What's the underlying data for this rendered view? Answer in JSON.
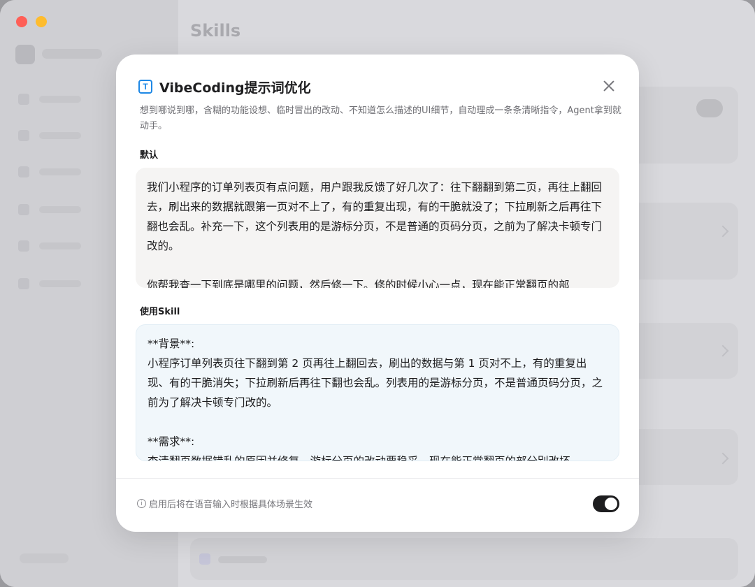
{
  "background": {
    "page_title": "Skills"
  },
  "modal": {
    "icon": "text-T-icon",
    "title": "VibeCoding提示词优化",
    "subtitle": "想到哪说到哪，含糊的功能设想、临时冒出的改动、不知道怎么描述的UI细节，自动理成一条条清晰指令，Agent拿到就动手。",
    "default_section": {
      "label": "默认",
      "paragraphs": [
        "我们小程序的订单列表页有点问题，用户跟我反馈了好几次了：往下翻翻到第二页，再往上翻回去，刷出来的数据就跟第一页对不上了，有的重复出现，有的干脆就没了；下拉刷新之后再往下翻也会乱。补充一下，这个列表用的是游标分页，不是普通的页码分页，之前为了解决卡顿专门改的。",
        "你帮我查一下到底是哪里的问题，然后修一下。修的时候小心一点，现在能正常翻页的部"
      ]
    },
    "skill_section": {
      "label": "使用Skill",
      "background_heading": "**背景**:",
      "background_text": "小程序订单列表页往下翻到第 2 页再往上翻回去，刷出的数据与第 1 页对不上，有的重复出现、有的干脆消失；下拉刷新后再往下翻也会乱。列表用的是游标分页，不是普通页码分页，之前为了解决卡顿专门改的。",
      "requirement_heading": "**需求**:",
      "requirement_text": "查清翻页数据错乱的原因并修复，游标分页的改动要稳妥，现在能正常翻页的部分别改坏"
    },
    "footer": {
      "note": "启用后将在语音输入时根据具体场景生效",
      "toggle_on": true
    }
  },
  "colors": {
    "accent": "#1e88e5",
    "toggle_on": "#1d1d1f",
    "skill_box_bg": "#f1f7fb",
    "default_box_bg": "#f5f4f3"
  }
}
